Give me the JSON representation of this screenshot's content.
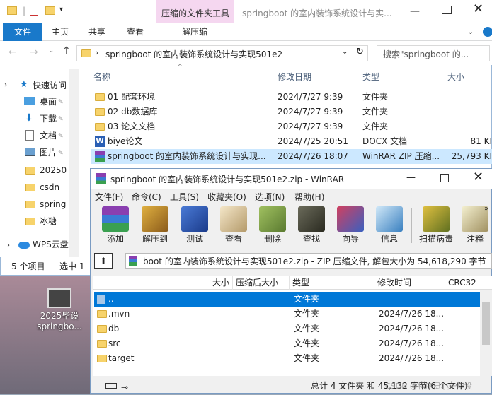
{
  "explorer": {
    "context_tab_title": "压缩的文件夹工具",
    "window_title": "springboot 的室内装饰系统设计与实...",
    "ribbon_tabs": [
      "文件",
      "主页",
      "共享",
      "查看"
    ],
    "context_tab_label": "解压缩",
    "address": "springboot 的室内装饰系统设计与实现501e2",
    "search_placeholder": "搜索\"springboot 的...",
    "headers": {
      "name": "名称",
      "date": "修改日期",
      "type": "类型",
      "size": "大小"
    },
    "files": [
      {
        "name": "01 配套环境",
        "date": "2024/7/27 9:39",
        "type": "文件夹",
        "size": "",
        "icon": "folder-icon"
      },
      {
        "name": "02 db数据库",
        "date": "2024/7/27 9:39",
        "type": "文件夹",
        "size": "",
        "icon": "folder-icon"
      },
      {
        "name": "03 论文文档",
        "date": "2024/7/27 9:39",
        "type": "文件夹",
        "size": "",
        "icon": "folder-icon"
      },
      {
        "name": "biye论文",
        "date": "2024/7/25 20:51",
        "type": "DOCX 文档",
        "size": "81 KI",
        "icon": "word-icon"
      },
      {
        "name": "springboot 的室内装饰系统设计与实现...",
        "date": "2024/7/26 18:07",
        "type": "WinRAR ZIP 压缩...",
        "size": "25,793 KI",
        "icon": "winrar-icon"
      }
    ],
    "sidebar": [
      {
        "label": "快速访问",
        "icon": "star-icon"
      },
      {
        "label": "桌面",
        "icon": "desktop-icon"
      },
      {
        "label": "下载",
        "icon": "download-icon"
      },
      {
        "label": "文档",
        "icon": "document-icon"
      },
      {
        "label": "图片",
        "icon": "picture-icon"
      },
      {
        "label": "20250",
        "icon": "folder-icon"
      },
      {
        "label": "csdn",
        "icon": "folder-icon"
      },
      {
        "label": "spring",
        "icon": "folder-icon"
      },
      {
        "label": "冰糖",
        "icon": "folder-icon"
      },
      {
        "label": "WPS云盘",
        "icon": "cloud-icon"
      }
    ],
    "status_count": "5 个项目",
    "status_selected": "选中 1"
  },
  "winrar": {
    "title": "springboot 的室内装饰系统设计与实现501e2.zip - WinRAR",
    "menu": [
      "文件(F)",
      "命令(C)",
      "工具(S)",
      "收藏夹(O)",
      "选项(N)",
      "帮助(H)"
    ],
    "toolbar": [
      "添加",
      "解压到",
      "测试",
      "查看",
      "删除",
      "查找",
      "向导",
      "信息",
      "扫描病毒",
      "注释"
    ],
    "path_text": "boot 的室内装饰系统设计与实现501e2.zip - ZIP 压缩文件, 解包大小为 54,618,290 字节",
    "headers": {
      "name": "",
      "size": "大小",
      "packed": "压缩后大小",
      "type": "类型",
      "modified": "修改时间",
      "crc": "CRC32"
    },
    "rows": [
      {
        "name": "..",
        "type": "文件夹",
        "modified": ""
      },
      {
        "name": ".mvn",
        "type": "文件夹",
        "modified": "2024/7/26 18..."
      },
      {
        "name": "db",
        "type": "文件夹",
        "modified": "2024/7/26 18..."
      },
      {
        "name": "src",
        "type": "文件夹",
        "modified": "2024/7/26 18..."
      },
      {
        "name": "target",
        "type": "文件夹",
        "modified": "2024/7/26 18..."
      }
    ],
    "status": "总计 4 文件夹 和 45,132 字节(6 个文件)"
  },
  "desktop": {
    "icon_label_1": "2025毕设",
    "icon_label_2": "springbo...",
    "watermark": "CSDN @程序员小一毕设"
  }
}
